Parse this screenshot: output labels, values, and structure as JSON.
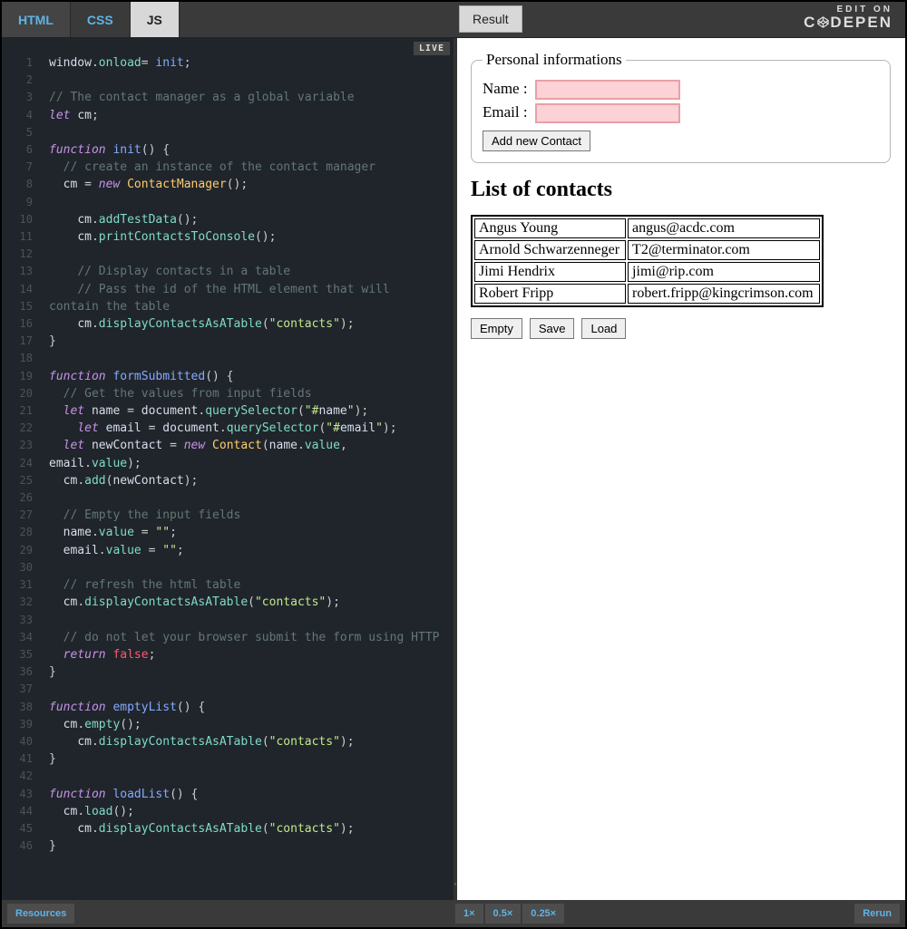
{
  "tabs": {
    "html": "HTML",
    "css": "CSS",
    "js": "JS"
  },
  "result_label": "Result",
  "edit_on": "EDIT ON",
  "codepen": "C   DEPEN",
  "live": "LIVE",
  "bottom": {
    "resources": "Resources",
    "zoom1": "1×",
    "zoom05": "0.5×",
    "zoom025": "0.25×",
    "rerun": "Rerun"
  },
  "result": {
    "legend": "Personal informations",
    "name_label": "Name :",
    "email_label": "Email :",
    "add_btn": "Add new Contact",
    "list_heading": "List of contacts",
    "contacts": [
      {
        "name": "Angus Young",
        "email": "angus@acdc.com"
      },
      {
        "name": "Arnold Schwarzenneger",
        "email": "T2@terminator.com"
      },
      {
        "name": "Jimi Hendrix",
        "email": "jimi@rip.com"
      },
      {
        "name": "Robert Fripp",
        "email": "robert.fripp@kingcrimson.com"
      }
    ],
    "empty_btn": "Empty",
    "save_btn": "Save",
    "load_btn": "Load"
  },
  "code_lines": [
    "window.onload= init;",
    "",
    "// The contact manager as a global variable",
    "let cm;",
    "",
    "function init() {",
    "  // create an instance of the contact manager",
    "  cm = new ContactManager();",
    "",
    "    cm.addTestData();",
    "    cm.printContactsToConsole();",
    "",
    "    // Display contacts in a table",
    "    // Pass the id of the HTML element that will contain the table",
    "    cm.displayContactsAsATable(\"contacts\");",
    "}",
    "",
    "function formSubmitted() {",
    "  // Get the values from input fields",
    "  let name = document.querySelector(\"#name\");",
    "    let email = document.querySelector(\"#email\");",
    "  let newContact = new Contact(name.value, email.value);",
    "  cm.add(newContact);",
    "",
    "  // Empty the input fields",
    "  name.value = \"\";",
    "  email.value = \"\";",
    "",
    "  // refresh the html table",
    "  cm.displayContactsAsATable(\"contacts\");",
    "",
    "  // do not let your browser submit the form using HTTP",
    "  return false;",
    "}",
    "",
    "function emptyList() {",
    "  cm.empty();",
    "    cm.displayContactsAsATable(\"contacts\");",
    "}",
    "",
    "function loadList() {",
    "  cm.load();",
    "    cm.displayContactsAsATable(\"contacts\");",
    "}",
    "",
    ""
  ],
  "gutter_numbers": [
    1,
    2,
    3,
    4,
    5,
    6,
    7,
    8,
    9,
    10,
    11,
    12,
    13,
    14,
    "",
    15,
    16,
    17,
    18,
    19,
    20,
    21,
    22,
    "",
    23,
    24,
    25,
    26,
    27,
    28,
    29,
    30,
    31,
    32,
    "",
    33,
    34,
    35,
    36,
    37,
    38,
    39,
    40,
    41,
    42,
    43,
    44,
    45,
    46
  ]
}
